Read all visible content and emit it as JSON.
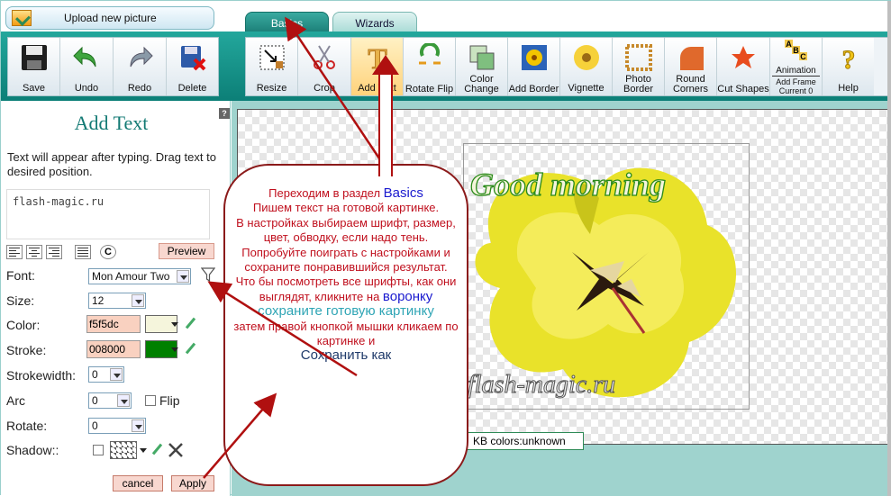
{
  "app": {
    "upload_label": "Upload new picture",
    "tabs": [
      {
        "label": "Basics",
        "active": true
      },
      {
        "label": "Wizards",
        "active": false
      }
    ]
  },
  "toolbar_left": [
    {
      "label": "Save",
      "icon": "floppy-icon"
    },
    {
      "label": "Undo",
      "icon": "undo-icon"
    },
    {
      "label": "Redo",
      "icon": "redo-icon"
    },
    {
      "label": "Delete",
      "icon": "delete-icon"
    }
  ],
  "toolbar_right": [
    {
      "label": "Resize",
      "icon": "resize-icon"
    },
    {
      "label": "Crop",
      "icon": "scissors-icon"
    },
    {
      "label": "Add Text",
      "icon": "text-icon",
      "active": true
    },
    {
      "label": "Rotate Flip",
      "icon": "rotate-icon"
    },
    {
      "label": "Color Change",
      "icon": "color-change-icon"
    },
    {
      "label": "Add Border",
      "icon": "border-icon"
    },
    {
      "label": "Vignette",
      "icon": "vignette-icon"
    },
    {
      "label": "Photo Border",
      "icon": "photo-border-icon"
    },
    {
      "label": "Round Corners",
      "icon": "round-corners-icon"
    },
    {
      "label": "Cut Shapes",
      "icon": "shapes-icon"
    },
    {
      "label": "Animation",
      "sub": "Add Frame",
      "sub2": "Current 0",
      "icon": "animation-icon"
    },
    {
      "label": "Help",
      "icon": "question-icon"
    }
  ],
  "panel": {
    "title": "Add Text",
    "help": "?",
    "desc": "Text will appear after typing. Drag text to desired position.",
    "text_value": "flash-magic.ru",
    "preview_label": "Preview",
    "font_label": "Font:",
    "font_value": "Mon Amour Two",
    "size_label": "Size:",
    "size_value": "12",
    "color_label": "Color:",
    "color_value": "f5f5dc",
    "color_swatch": "#f5f5dc",
    "stroke_label": "Stroke:",
    "stroke_value": "008000",
    "stroke_swatch": "#008000",
    "strokewidth_label": "Strokewidth:",
    "strokewidth_value": "0",
    "arc_label": "Arc",
    "arc_value": "0",
    "flip_label": "Flip",
    "rotate_label": "Rotate:",
    "rotate_value": "0",
    "shadow_label": "Shadow::",
    "shadow_swatch": "#333333",
    "cancel_label": "cancel",
    "apply_label": "Apply"
  },
  "canvas": {
    "overlay_text": "Good morning",
    "watermark_text": "flash-magic.ru",
    "info_text": "KB  colors:unknown"
  },
  "annotation": {
    "line1a": "Переходим в раздел ",
    "line1b": "Basics",
    "line2": "Пишем текст на готовой картинке.",
    "line3": "В настройках выбираем шрифт, размер, цвет, обводку, если надо тень. Попробуйте поиграть с настройками и сохраните понравившийся результат.",
    "line4": "Что бы посмотреть все шрифты, как они выглядят, кликните на ",
    "line4b": "воронку",
    "line5": "сохраните готовую картинку",
    "line6": "затем правой кнопкой мышки кликаем по картинке и",
    "line7": "Сохранить как"
  },
  "colors": {
    "accent": "#1c8f86",
    "annotation_red": "#c0101e",
    "arrow": "#b01010"
  }
}
